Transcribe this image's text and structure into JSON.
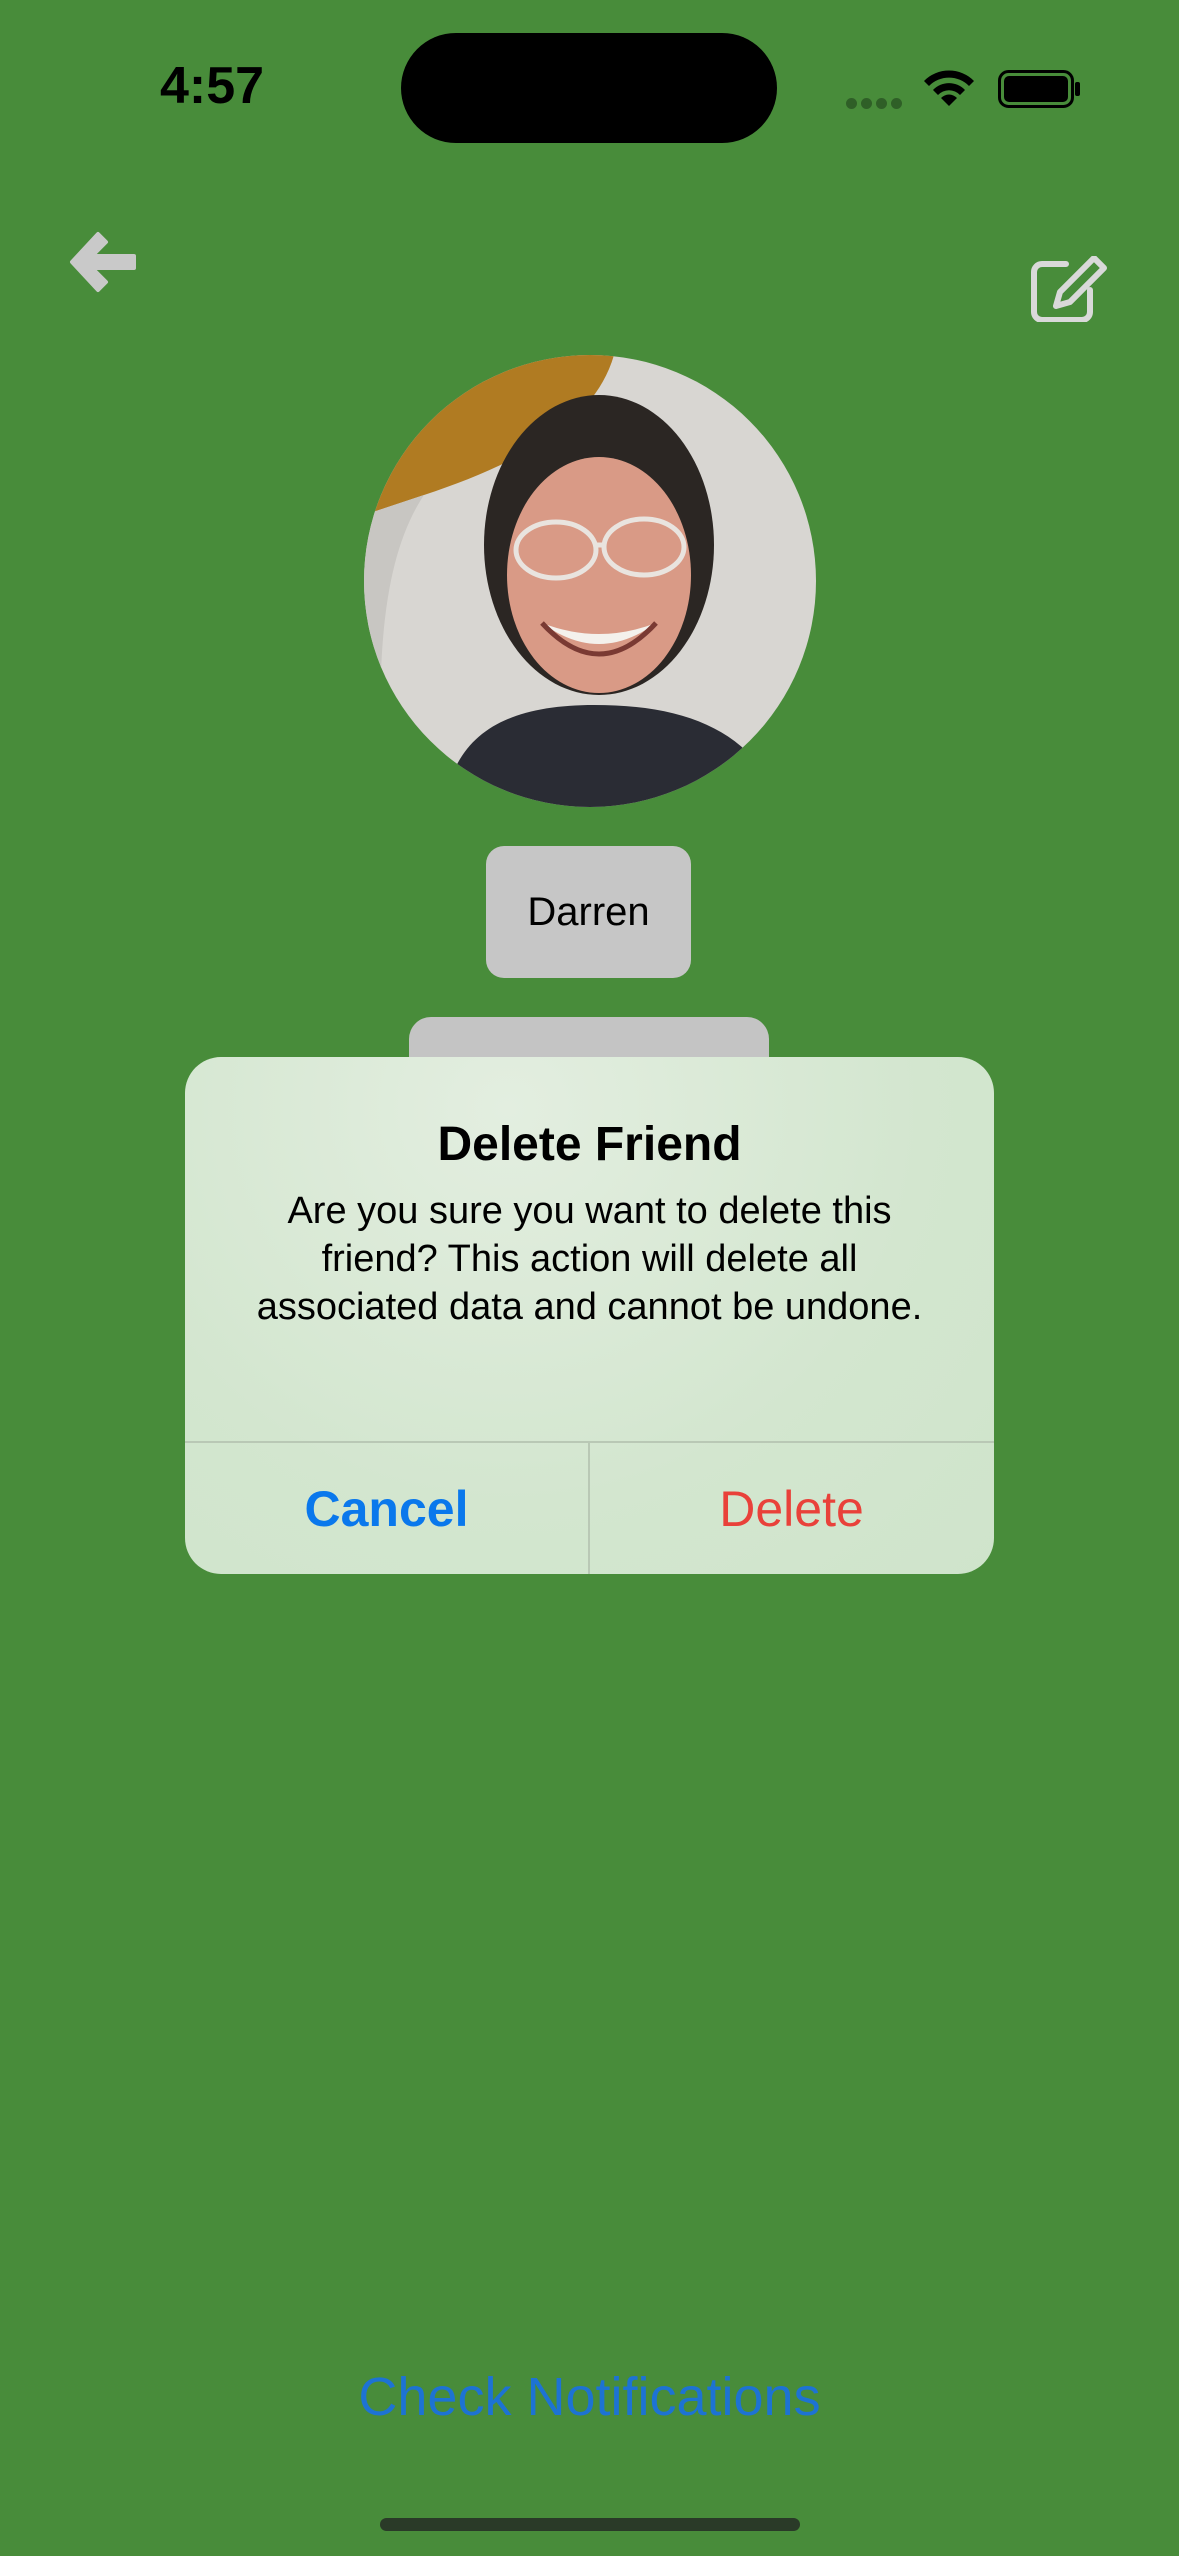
{
  "status_bar": {
    "time": "4:57"
  },
  "profile": {
    "name": "Darren"
  },
  "alert": {
    "title": "Delete Friend",
    "message": "Are you sure you want to delete this friend? This action will delete all associated data and cannot be undone.",
    "cancel_label": "Cancel",
    "delete_label": "Delete"
  },
  "footer": {
    "check_notifications_label": "Check Notifications"
  },
  "icons": {
    "back": "arrow-left-icon",
    "edit": "edit-square-pencil-icon",
    "wifi": "wifi-icon",
    "battery": "battery-icon"
  },
  "colors": {
    "background": "#488c3a",
    "cancel": "#0a78ec",
    "delete": "#e9413a",
    "link": "#1d73d3"
  }
}
